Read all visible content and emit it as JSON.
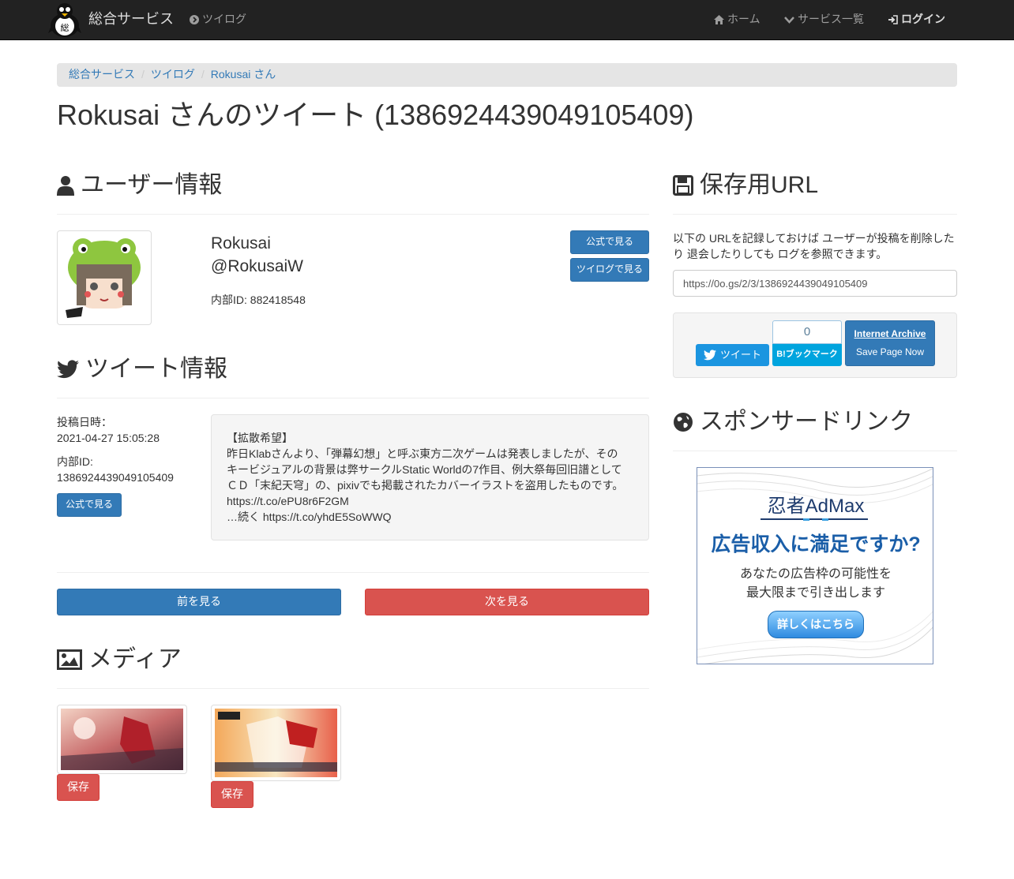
{
  "navbar": {
    "brand_name": "総合サービス",
    "brand_logo_char": "総",
    "tsuilog_link": "ツイログ",
    "home_link": "ホーム",
    "services_link": "サービス一覧",
    "login_link": "ログイン"
  },
  "breadcrumb": [
    "総合サービス",
    "ツイログ",
    "Rokusai さん"
  ],
  "page_title": "Rokusai さんのツイート (1386924439049105409)",
  "user_section": {
    "heading": "ユーザー情報",
    "name": "Rokusai",
    "handle": "@RokusaiW",
    "internal_id_label": "内部ID: 882418548",
    "official_button": "公式で見る",
    "tsuilog_button": "ツイログで見る"
  },
  "tweet_section": {
    "heading": "ツイート情報",
    "posted_label": "投稿日時：",
    "posted_value": "2021-04-27 15:05:28",
    "id_label": "内部ID:",
    "id_value": "1386924439049105409",
    "official_button": "公式で見る",
    "text_lines": [
      "【拡散希望】",
      "昨日Klabさんより、「弾幕幻想」と呼ぶ東方二次ゲームは発表しましたが、その",
      "キービジュアルの背景は弊サークルStatic Worldの7作目、例大祭毎回旧譜として",
      "ＣＤ「末紀天穹」の、pixivでも掲載されたカバーイラストを盗用したものです。",
      "https://t.co/ePU8r6F2GM",
      "…続く https://t.co/yhdE5SoWWQ"
    ]
  },
  "pager": {
    "prev": "前を見る",
    "next": "次を見る"
  },
  "media_section": {
    "heading": "メディア",
    "save_button": "保存"
  },
  "save_url_section": {
    "heading": "保存用URL",
    "description": "以下の URLを記録しておけば ユーザーが投稿を削除したり 退会したりしても ログを参照できます。",
    "url": "https://0o.gs/2/3/1386924439049105409",
    "tweet_button": "ツイート",
    "bookmark_count": "0",
    "bookmark_label": "B!ブックマーク",
    "archive_title": "Internet Archive",
    "archive_sub": "Save Page Now"
  },
  "sponsor_section": {
    "heading": "スポンサードリンク",
    "ad_brand": "忍者AdMax",
    "ad_headline": "広告収入に満足ですか?",
    "ad_line1": "あなたの広告枠の可能性を",
    "ad_line2": "最大限まで引き出します",
    "ad_button": "詳しくはこちら"
  },
  "colors": {
    "navbar_bg": "#222222",
    "primary": "#337ab7",
    "danger": "#d9534f",
    "twitter": "#1b95e0",
    "hatena": "#00a4de"
  }
}
